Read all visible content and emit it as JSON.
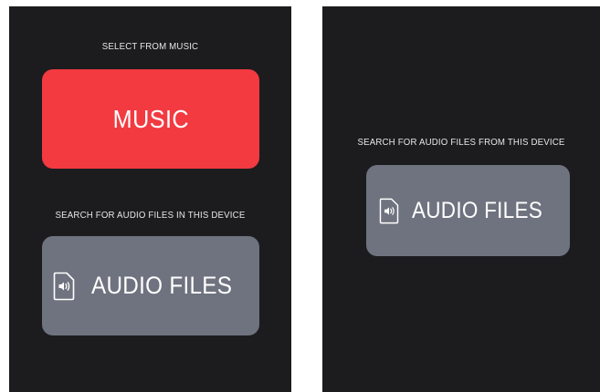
{
  "left_screen": {
    "music_caption": "SELECT FROM MUSIC",
    "music_button_label": "MUSIC",
    "audio_caption": "SEARCH FOR AUDIO FILES IN THIS DEVICE",
    "audio_button_label": "AUDIO FILES",
    "audio_icon": "audio-file-icon"
  },
  "right_screen": {
    "audio_caption": "SEARCH FOR AUDIO FILES FROM THIS DEVICE",
    "audio_button_label": "AUDIO FILES",
    "audio_icon": "audio-file-icon"
  },
  "colors": {
    "background": "#1c1c1f",
    "music_button": "#f23a40",
    "audio_button": "#6f737f",
    "text": "#ffffff"
  }
}
